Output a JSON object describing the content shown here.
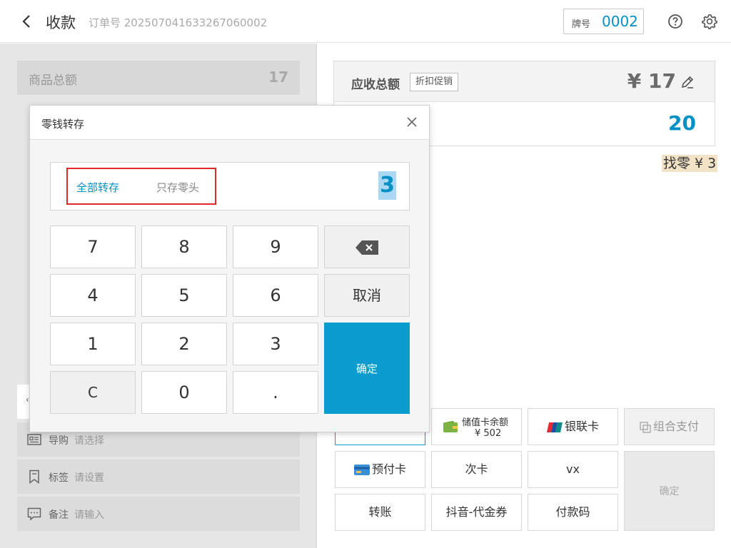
{
  "header": {
    "title": "收款",
    "order_no": "订单号 20250704163326706000​2",
    "pai_label": "牌号",
    "pai_num": "0002"
  },
  "left": {
    "total_label": "商品总额",
    "total_value": "17",
    "rows": [
      {
        "key": "导购",
        "value": "请选择"
      },
      {
        "key": "标签",
        "value": "请设置"
      },
      {
        "key": "备注",
        "value": "请输入"
      }
    ]
  },
  "right": {
    "due_label": "应收总额",
    "discount_label": "折扣促销",
    "due_amount": "¥ 17",
    "paid_amount": "20",
    "change_text": "找零 ¥ 3",
    "pay": {
      "stored_value": "储值卡余额",
      "stored_value_amt": "¥ 502",
      "unionpay": "银联卡",
      "combo": "组合支付",
      "prepaid": "预付卡",
      "times_card": "次卡",
      "vx": "vx",
      "transfer": "转账",
      "douyin": "抖音-代金券",
      "pay_code": "付款码",
      "confirm": "确定"
    }
  },
  "modal": {
    "title": "零钱转存",
    "mode_all": "全部转存",
    "mode_change": "只存零头",
    "value": "3",
    "keys": {
      "k7": "7",
      "k8": "8",
      "k9": "9",
      "k4": "4",
      "k5": "5",
      "k6": "6",
      "k1": "1",
      "k2": "2",
      "k3": "3",
      "kc": "C",
      "k0": "0",
      "kdot": ".",
      "cancel": "取消",
      "confirm": "确定"
    }
  },
  "colors": {
    "accent": "#0090c6",
    "confirm_bg": "#0a9ccf",
    "highlight_red": "#e02a2a"
  }
}
